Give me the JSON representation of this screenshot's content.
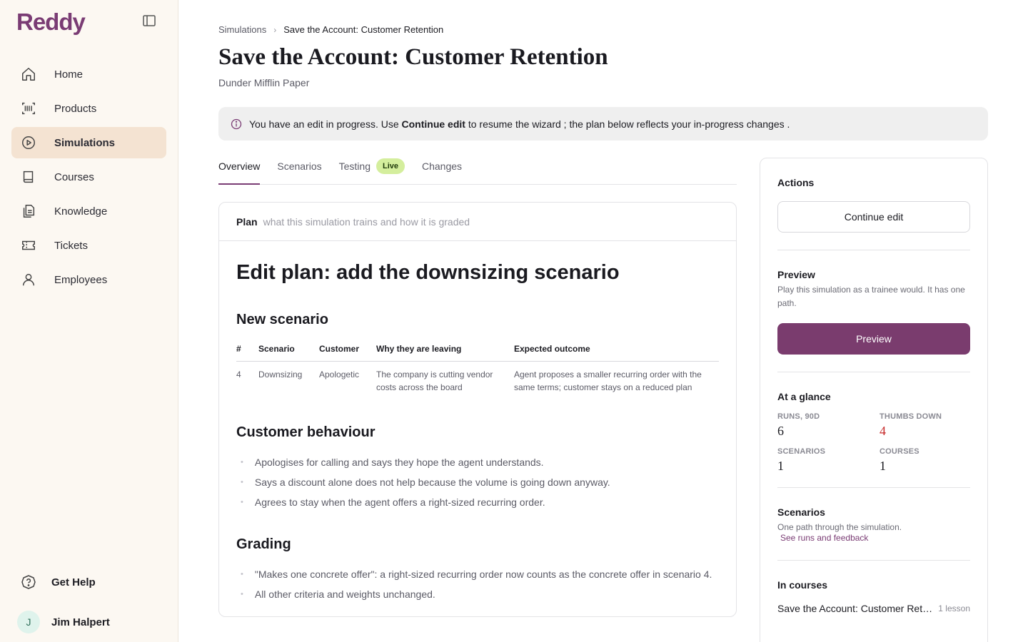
{
  "app": {
    "logo": "Reddy"
  },
  "sidebar": {
    "items": [
      {
        "label": "Home",
        "icon": "home-icon"
      },
      {
        "label": "Products",
        "icon": "barcode-icon"
      },
      {
        "label": "Simulations",
        "icon": "play-circle-icon",
        "active": true
      },
      {
        "label": "Courses",
        "icon": "book-icon"
      },
      {
        "label": "Knowledge",
        "icon": "documents-icon"
      },
      {
        "label": "Tickets",
        "icon": "ticket-icon"
      },
      {
        "label": "Employees",
        "icon": "user-icon"
      }
    ],
    "help_label": "Get Help",
    "user": {
      "initial": "J",
      "name": "Jim Halpert"
    }
  },
  "breadcrumb": {
    "parent": "Simulations",
    "current": "Save the Account: Customer Retention"
  },
  "page": {
    "title": "Save the Account: Customer Retention",
    "subtitle": "Dunder Mifflin Paper"
  },
  "banner": {
    "pre": "You have an edit in progress. Use ",
    "bold": "Continue edit",
    "post": " to resume the wizard ; the plan below reflects your in-progress changes ."
  },
  "tabs": [
    {
      "label": "Overview",
      "active": true
    },
    {
      "label": "Scenarios"
    },
    {
      "label": "Testing",
      "badge": "Live"
    },
    {
      "label": "Changes"
    }
  ],
  "plan": {
    "label": "Plan",
    "hint": "what this simulation trains and how it is graded",
    "heading": "Edit plan: add the downsizing scenario",
    "new_scenario": {
      "heading": "New scenario",
      "columns": [
        "#",
        "Scenario",
        "Customer",
        "Why they are leaving",
        "Expected outcome"
      ],
      "rows": [
        {
          "num": "4",
          "scenario": "Downsizing",
          "customer": "Apologetic",
          "why": "The company is cutting vendor costs across the board",
          "outcome": "Agent proposes a smaller recurring order with the same terms; customer stays on a reduced plan"
        }
      ]
    },
    "behaviour": {
      "heading": "Customer behaviour",
      "items": [
        "Apologises for calling and says they hope the agent understands.",
        "Says a discount alone does not help because the volume is going down anyway.",
        "Agrees to stay when the agent offers a right-sized recurring order."
      ]
    },
    "grading": {
      "heading": "Grading",
      "items": [
        "\"Makes one concrete offer\": a right-sized recurring order now counts as the concrete offer in scenario 4.",
        "All other criteria and weights unchanged."
      ]
    }
  },
  "side": {
    "actions": {
      "title": "Actions",
      "continue_label": "Continue edit"
    },
    "preview": {
      "title": "Preview",
      "desc": "Play this simulation as a trainee would. It has one path.",
      "button": "Preview"
    },
    "glance": {
      "title": "At a glance",
      "stats": [
        {
          "label": "RUNS, 90D",
          "value": "6"
        },
        {
          "label": "THUMBS DOWN",
          "value": "4",
          "color": "#c62828"
        },
        {
          "label": "SCENARIOS",
          "value": "1"
        },
        {
          "label": "COURSES",
          "value": "1"
        }
      ]
    },
    "scenarios": {
      "title": "Scenarios",
      "desc": "One path through the simulation.",
      "link": "See runs and feedback"
    },
    "courses": {
      "title": "In courses",
      "items": [
        {
          "name": "Save the Account: Customer Retention",
          "meta": "1 lesson"
        }
      ]
    }
  },
  "colors": {
    "brand": "#7a3c74",
    "active_nav_bg": "#f4e3d2",
    "live_badge": "#d4ee9d",
    "alert": "#c62828"
  }
}
